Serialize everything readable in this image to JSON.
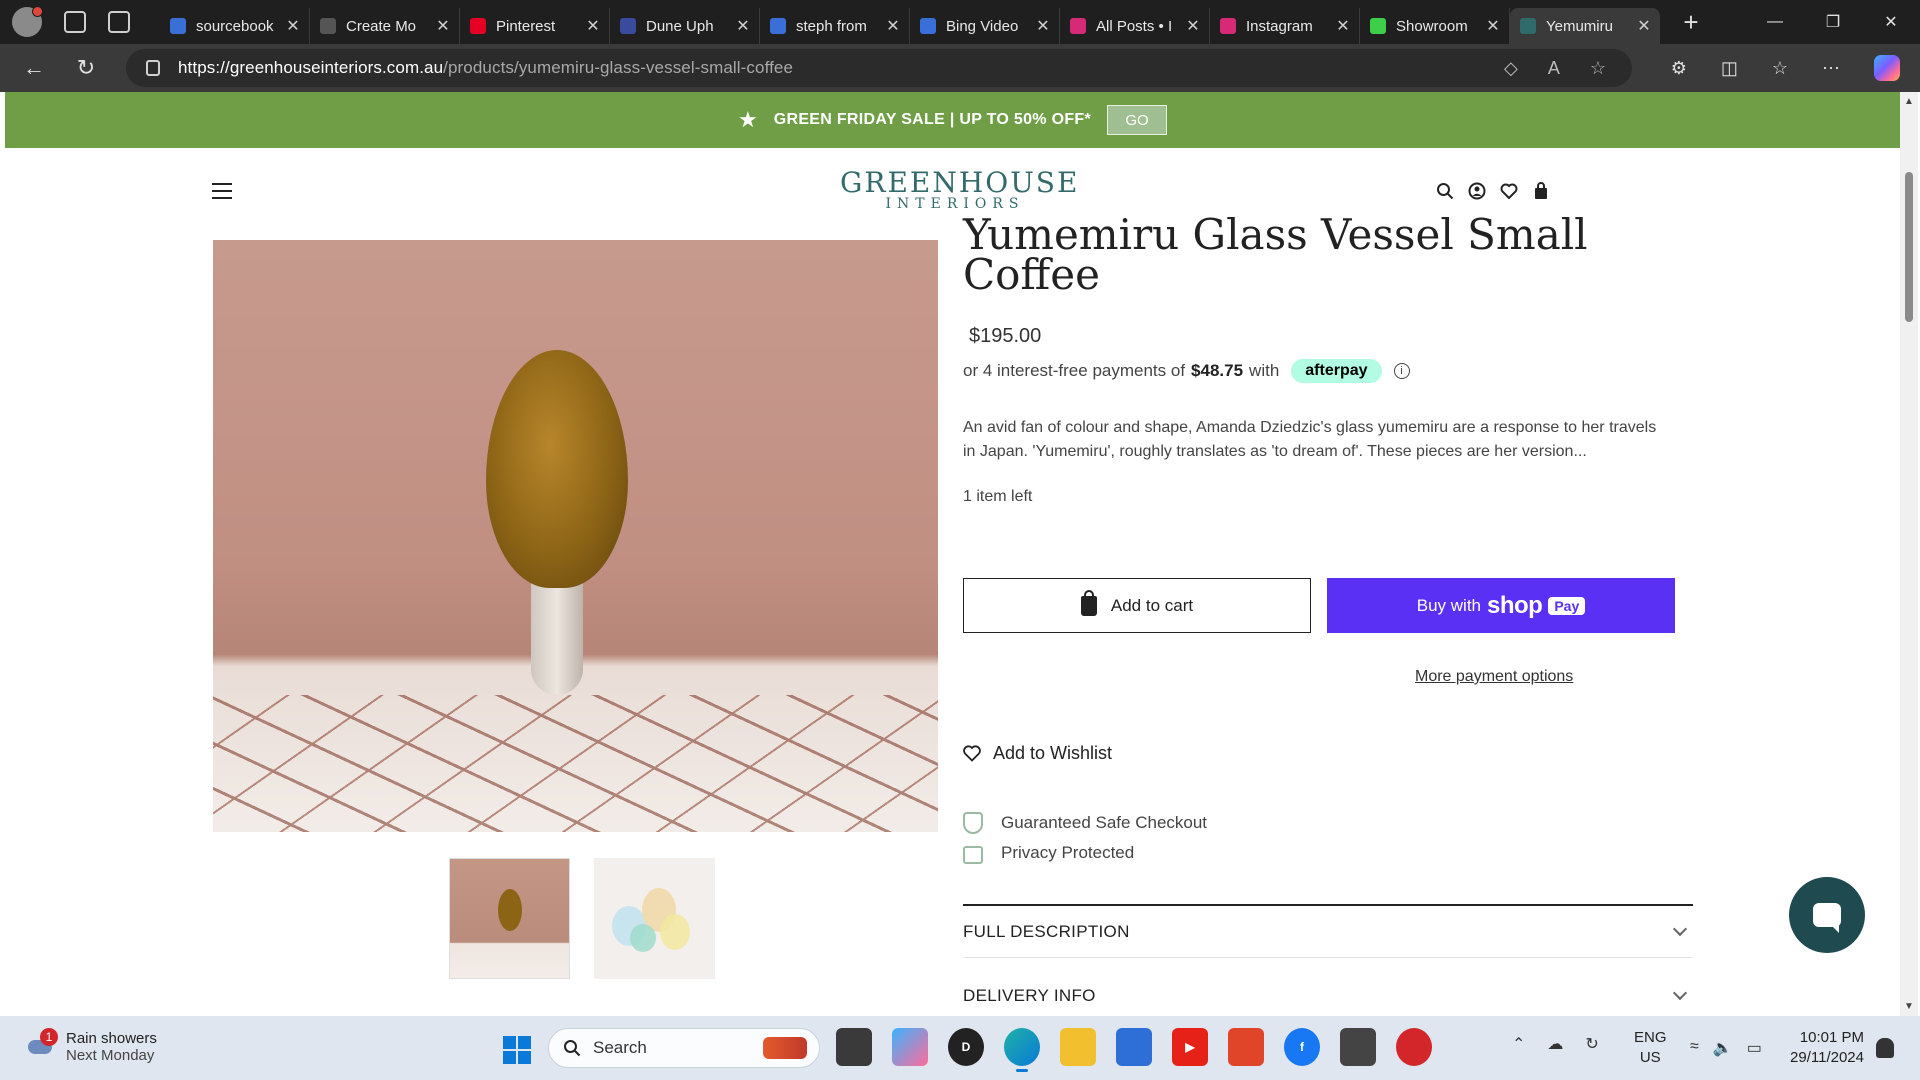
{
  "browser": {
    "tabs": [
      {
        "title": "sourcebook",
        "favicon_color": "#3b6fd8"
      },
      {
        "title": "Create Mo",
        "favicon_color": "#555555"
      },
      {
        "title": "Pinterest",
        "favicon_color": "#e60023"
      },
      {
        "title": "Dune Uph",
        "favicon_color": "#3a4a9c"
      },
      {
        "title": "steph from",
        "favicon_color": "#3b6fd8"
      },
      {
        "title": "Bing Video",
        "favicon_color": "#3b6fd8"
      },
      {
        "title": "All Posts • I",
        "favicon_color": "#d62976"
      },
      {
        "title": "Instagram",
        "favicon_color": "#d62976"
      },
      {
        "title": "Showroom",
        "favicon_color": "#3ecf4a"
      },
      {
        "title": "Yemumiru",
        "favicon_color": "#2e6b6a",
        "active": true
      }
    ],
    "url_host": "https://greenhouseinteriors.com.au",
    "url_path": "/products/yumemiru-glass-vessel-small-coffee"
  },
  "promo": {
    "text": "GREEN FRIDAY SALE | UP TO 50% OFF*",
    "go_label": "GO"
  },
  "header": {
    "logo_main": "GREENHOUSE",
    "logo_sub": "INTERIORS"
  },
  "product": {
    "title_partial": "Yumemiru Glass Vessel Small",
    "title_line2": "Coffee",
    "price": "$195.00",
    "afterpay_prefix": "or 4 interest-free payments of",
    "afterpay_amount": "$48.75",
    "afterpay_with": "with",
    "afterpay_brand": "afterpay",
    "description": "An avid fan of colour and shape, Amanda Dziedzic's glass yumemiru are a response to her travels in Japan. 'Yumemiru', roughly translates as 'to dream of'. These pieces are her version...",
    "stock": "1 item left",
    "add_to_cart": "Add to cart",
    "buy_with": "Buy with",
    "shop_word": "shop",
    "pay_word": "Pay",
    "more_payment": "More payment options",
    "wishlist": "Add to Wishlist",
    "trust": [
      "Guaranteed Safe Checkout",
      "Privacy Protected"
    ],
    "accordions": [
      "FULL DESCRIPTION",
      "DELIVERY INFO"
    ]
  },
  "taskbar": {
    "weather_badge": "1",
    "weather_title": "Rain showers",
    "weather_sub": "Next Monday",
    "search_placeholder": "Search",
    "lang_line1": "ENG",
    "lang_line2": "US",
    "time": "10:01 PM",
    "date": "29/11/2024"
  },
  "colors": {
    "promo_green": "#6f9e46",
    "shop_pay_purple": "#5a31f4",
    "afterpay_mint": "#b2fce4",
    "logo_teal": "#346b6a",
    "chat_teal": "#1e4a50"
  }
}
